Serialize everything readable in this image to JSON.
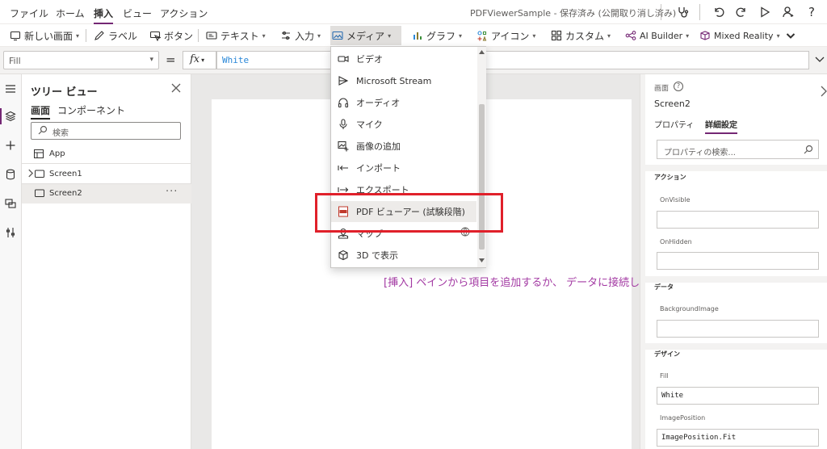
{
  "menubar": {
    "items": [
      "ファイル",
      "ホーム",
      "挿入",
      "ビュー",
      "アクション"
    ],
    "active_index": 2,
    "app_status": "PDFViewerSample - 保存済み (公開取り消し済み)",
    "icons": [
      "stethoscope-icon",
      "undo-icon",
      "redo-icon",
      "play-icon",
      "user-icon",
      "help-icon"
    ],
    "help_label": "?"
  },
  "ribbon": {
    "new_screen": "新しい画面",
    "label": "ラベル",
    "button": "ボタン",
    "text": "テキスト",
    "input": "入力",
    "media": "メディア",
    "chart": "グラフ",
    "icons": "アイコン",
    "custom": "カスタム",
    "ai_builder": "AI Builder",
    "mixed_reality": "Mixed Reality",
    "chevron": "▾"
  },
  "formula": {
    "property": "Fill",
    "equals": "=",
    "fx": "fx",
    "value": "White"
  },
  "tree": {
    "title": "ツリー ビュー",
    "tabs": [
      "画面",
      "コンポーネント"
    ],
    "search_placeholder": "検索",
    "items": [
      {
        "label": "App"
      },
      {
        "label": "Screen1"
      },
      {
        "label": "Screen2"
      }
    ],
    "more": "···"
  },
  "media_menu": {
    "items": [
      {
        "label": "ビデオ",
        "icon": "video-icon"
      },
      {
        "label": "Microsoft Stream",
        "icon": "stream-icon"
      },
      {
        "label": "オーディオ",
        "icon": "audio-icon"
      },
      {
        "label": "マイク",
        "icon": "microphone-icon"
      },
      {
        "label": "画像の追加",
        "icon": "add-image-icon"
      },
      {
        "label": "インポート",
        "icon": "import-icon"
      },
      {
        "label": "エクスポート",
        "icon": "export-icon"
      },
      {
        "label": "PDF ビューアー (試験段階)",
        "icon": "pdf-icon"
      },
      {
        "label": "マップ",
        "icon": "map-icon"
      },
      {
        "label": "3D で表示",
        "icon": "cube-icon"
      }
    ],
    "hovered_index": 7
  },
  "canvas": {
    "hint": "[挿入] ペインから項目を追加するか、 データに接続し"
  },
  "props": {
    "kind": "画面",
    "help": "?",
    "name": "Screen2",
    "tabs": [
      "プロパティ",
      "詳細設定"
    ],
    "active_tab": 1,
    "search_placeholder": "プロパティの検索...",
    "sections": {
      "actions": "アクション",
      "data": "データ",
      "design": "デザイン"
    },
    "fields": {
      "onvisible": {
        "label": "OnVisible",
        "value": ""
      },
      "onhidden": {
        "label": "OnHidden",
        "value": ""
      },
      "background_image": {
        "label": "BackgroundImage",
        "value": ""
      },
      "fill": {
        "label": "Fill",
        "value": "White"
      },
      "image_position": {
        "label": "ImagePosition",
        "value": "ImagePosition.Fit"
      }
    }
  },
  "colors": {
    "accent": "#742774",
    "highlight": "#e0202a",
    "formula_text": "#2b88d8",
    "hint_text": "#a33aa3"
  }
}
